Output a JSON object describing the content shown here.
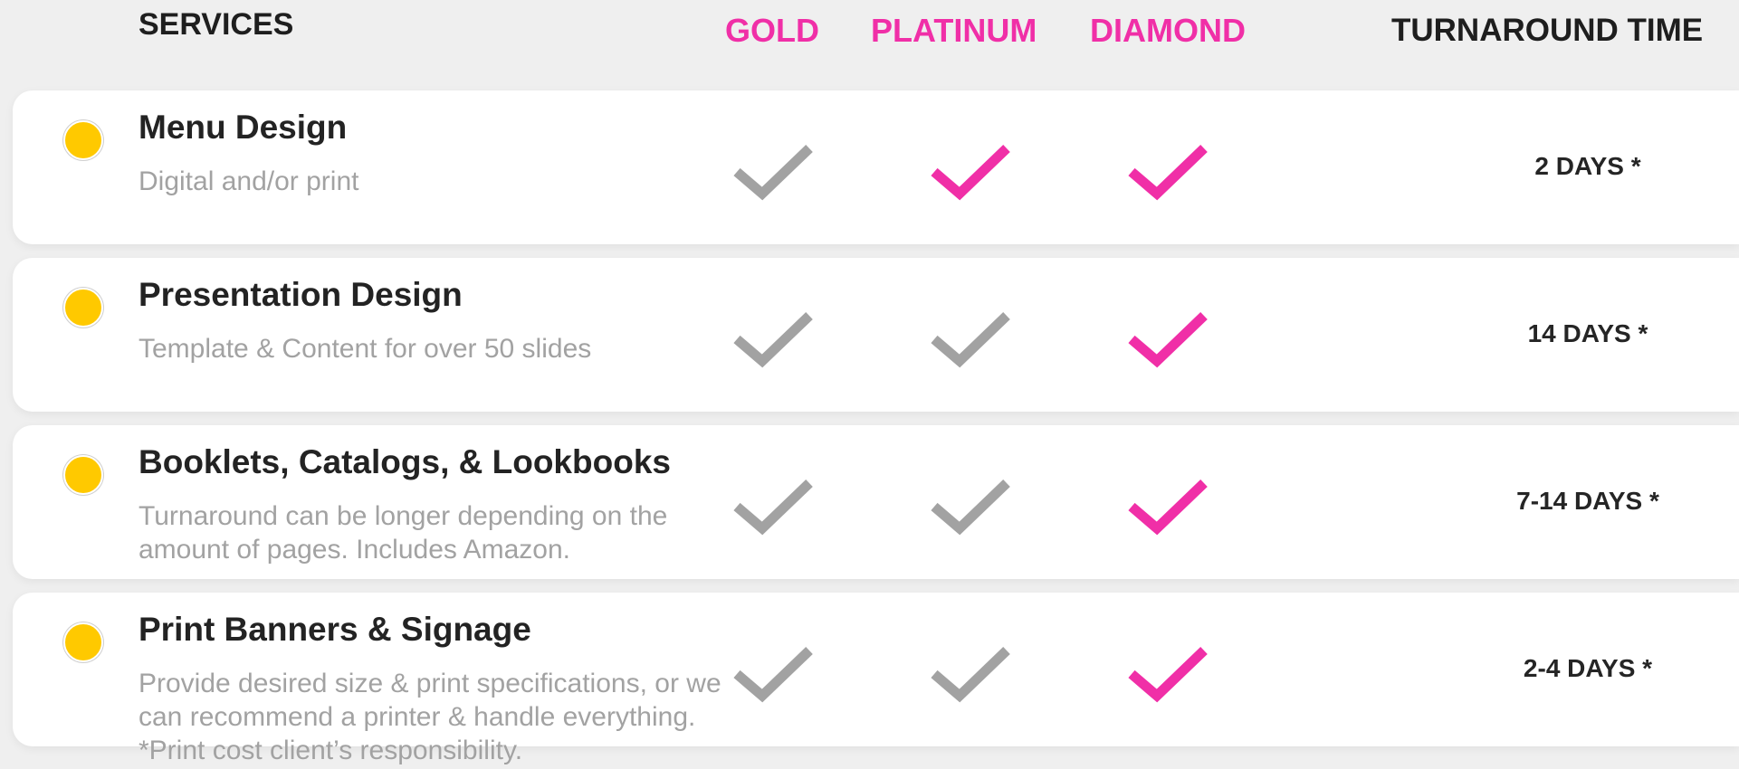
{
  "header": {
    "services": "SERVICES",
    "gold": "GOLD",
    "platinum": "PLATINUM",
    "diamond": "DIAMOND",
    "turnaround": "TURNAROUND TIME"
  },
  "icons": {
    "bullet": "yellow-dot-icon",
    "included": "checkmark-icon"
  },
  "colors": {
    "accent": "#f02fa7",
    "bullet": "#ffc900",
    "muted_check": "#a2a2a2",
    "text": "#232323",
    "description": "#a2a2a2"
  },
  "services": [
    {
      "title": "Menu Design",
      "description": "Digital and/or print",
      "gold": "grey",
      "platinum": "pink",
      "diamond": "pink",
      "turnaround": "2 DAYS *"
    },
    {
      "title": "Presentation Design",
      "description": "Template & Content for over 50 slides",
      "gold": "grey",
      "platinum": "grey",
      "diamond": "pink",
      "turnaround": "14 DAYS *"
    },
    {
      "title": "Booklets, Catalogs, & Lookbooks",
      "description": "Turnaround can be longer depending on the amount of pages. Includes Amazon.",
      "gold": "grey",
      "platinum": "grey",
      "diamond": "pink",
      "turnaround": "7-14 DAYS *"
    },
    {
      "title": "Print Banners & Signage",
      "description": "Provide desired size & print specifications, or we can recommend a printer & handle everything. *Print cost client’s responsibility.",
      "gold": "grey",
      "platinum": "grey",
      "diamond": "pink",
      "turnaround": "2-4 DAYS *"
    }
  ]
}
